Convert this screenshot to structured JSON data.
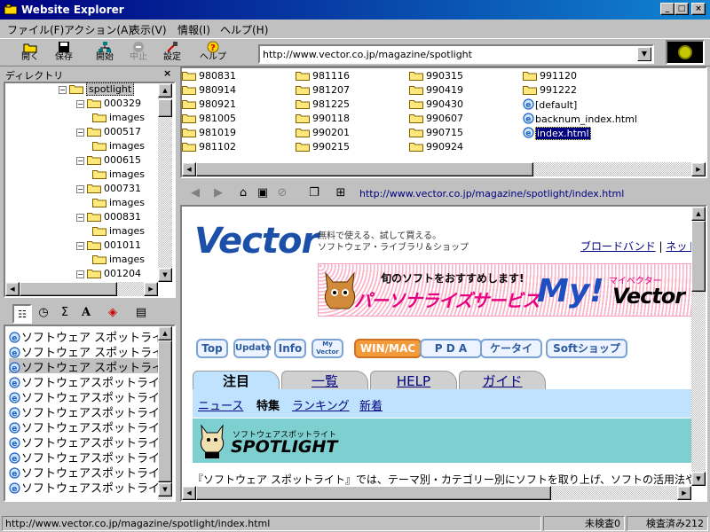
{
  "window": {
    "title": "Website Explorer"
  },
  "menu": [
    "ファイル(F)",
    "アクション(A)",
    "表示(V)",
    "情報(I)",
    "ヘルプ(H)"
  ],
  "toolbar": {
    "open": "開く",
    "save": "保存",
    "start": "開始",
    "stop": "中止",
    "settings": "設定",
    "help": "ヘルプ",
    "url": "http://www.vector.co.jp/magazine/spotlight"
  },
  "dir_panel": {
    "title": "ディレクトリ",
    "close": "×",
    "nodes": [
      {
        "label": "spotlight"
      },
      {
        "label": "000329"
      },
      {
        "label": "images"
      },
      {
        "label": "000517"
      },
      {
        "label": "images"
      },
      {
        "label": "000615"
      },
      {
        "label": "images"
      },
      {
        "label": "000731"
      },
      {
        "label": "images"
      },
      {
        "label": "000831"
      },
      {
        "label": "images"
      },
      {
        "label": "001011"
      },
      {
        "label": "images"
      },
      {
        "label": "001204"
      }
    ]
  },
  "history": [
    "ソフトウェア スポットライト",
    "ソフトウェア スポットライト",
    "ソフトウェア スポットライト",
    "ソフトウェアスポットライト",
    "ソフトウェアスポットライト",
    "ソフトウェアスポットライト",
    "ソフトウェアスポットライト",
    "ソフトウェアスポットライト",
    "ソフトウェアスポットライト",
    "ソフトウェアスポットライト",
    "ソフトウェアスポットライト"
  ],
  "files": [
    [
      "980831",
      "981116",
      "990315",
      "991120"
    ],
    [
      "980914",
      "981207",
      "990419",
      "991222"
    ],
    [
      "980921",
      "981225",
      "990430",
      "[default]"
    ],
    [
      "981005",
      "990118",
      "990607",
      "backnum_index.html"
    ],
    [
      "981019",
      "990201",
      "990715",
      "index.html"
    ],
    [
      "981102",
      "990215",
      "990924",
      ""
    ]
  ],
  "nav_url": "http://www.vector.co.jp/magazine/spotlight/index.html",
  "web": {
    "logo": "Vector",
    "tagline1": "無料で使える、試して買える。",
    "tagline2": "ソフトウェア・ライブラリ＆ショップ",
    "link_broadband": "ブロードバンド",
    "link_sep": "|",
    "link_netgame": "ネットゲ",
    "banner_top": "旬のソフトをおすすめします!",
    "banner_main": "パーソナライズサービス",
    "banner_my": "My!",
    "banner_myvector": "マイベクター",
    "banner_vector": "Vector",
    "buttons": [
      "Top",
      "Update",
      "Info",
      "My Vector",
      "WIN/MAC",
      "P D A",
      "ケータイ",
      "Softショップ"
    ],
    "tabs": [
      "注目",
      "一覧",
      "HELP",
      "ガイド"
    ],
    "subnav": [
      "ニュース",
      "特集",
      "ランキング",
      "新着"
    ],
    "spot_sub": "ソフトウェアスポットライト",
    "spot_title": "SPOTLIGHT",
    "body": "『ソフトウェア スポットライト』では、テーマ別・カテゴリー別にソフトを取り上げ、ソフトの活用法や上手な"
  },
  "status": {
    "url": "http://www.vector.co.jp/magazine/spotlight/index.html",
    "unchecked": "未検査0",
    "checked": "検査済み212"
  }
}
